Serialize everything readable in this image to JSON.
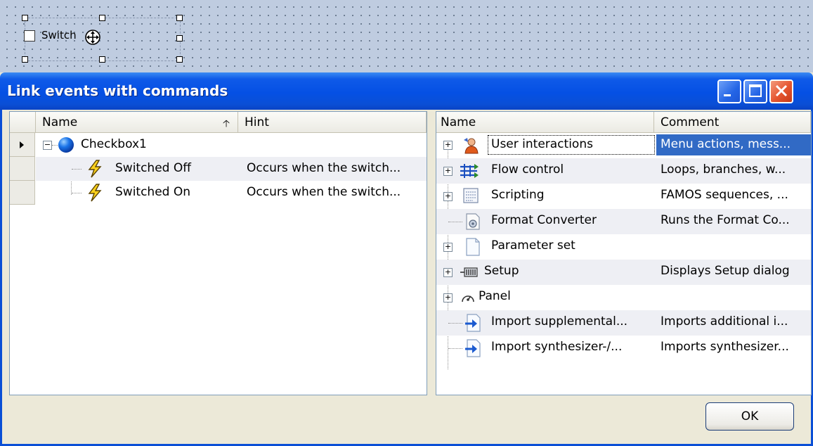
{
  "canvas": {
    "switch_label": "Switch"
  },
  "window": {
    "title": "Link events with commands",
    "buttons": {
      "minimize": "minimize-icon",
      "maximize": "maximize-icon",
      "close": "close-icon"
    }
  },
  "events_panel": {
    "columns": {
      "name": "Name",
      "hint": "Hint"
    },
    "sort_icon": "sort-ascending-icon",
    "root": {
      "label": "Checkbox1",
      "icon": "blue-sphere-icon"
    },
    "events": [
      {
        "name": "Switched Off",
        "hint": "Occurs when the switch...",
        "icon": "lightning-icon"
      },
      {
        "name": "Switched On",
        "hint": "Occurs when the switch...",
        "icon": "lightning-icon"
      }
    ]
  },
  "commands_panel": {
    "columns": {
      "name": "Name",
      "comment": "Comment"
    },
    "items": [
      {
        "name": "User interactions",
        "comment": "Menu actions, mess...",
        "icon": "user-icon",
        "expandable": true
      },
      {
        "name": "Flow control",
        "comment": "Loops, branches, w...",
        "icon": "flow-icon",
        "expandable": true
      },
      {
        "name": "Scripting",
        "comment": "FAMOS sequences, ...",
        "icon": "script-icon",
        "expandable": true
      },
      {
        "name": "Format Converter",
        "comment": "Runs the Format Co...",
        "icon": "converter-icon",
        "expandable": false
      },
      {
        "name": "Parameter set",
        "comment": "",
        "icon": "document-icon",
        "expandable": true
      },
      {
        "name": "Setup",
        "comment": "Displays Setup dialog",
        "icon": "setup-icon",
        "expandable": true
      },
      {
        "name": "Panel",
        "comment": "",
        "icon": "gauge-icon",
        "expandable": true
      },
      {
        "name": "Import supplemental...",
        "comment": "Imports additional i...",
        "icon": "import-icon",
        "expandable": false
      },
      {
        "name": "Import synthesizer-/...",
        "comment": "Imports synthesizer...",
        "icon": "import-icon",
        "expandable": false
      }
    ]
  },
  "footer": {
    "ok_label": "OK"
  },
  "colors": {
    "titlebar": "#0550e4",
    "selection": "#316ac5",
    "panel_border": "#7f9db9",
    "dialog_bg": "#ece9d8"
  }
}
